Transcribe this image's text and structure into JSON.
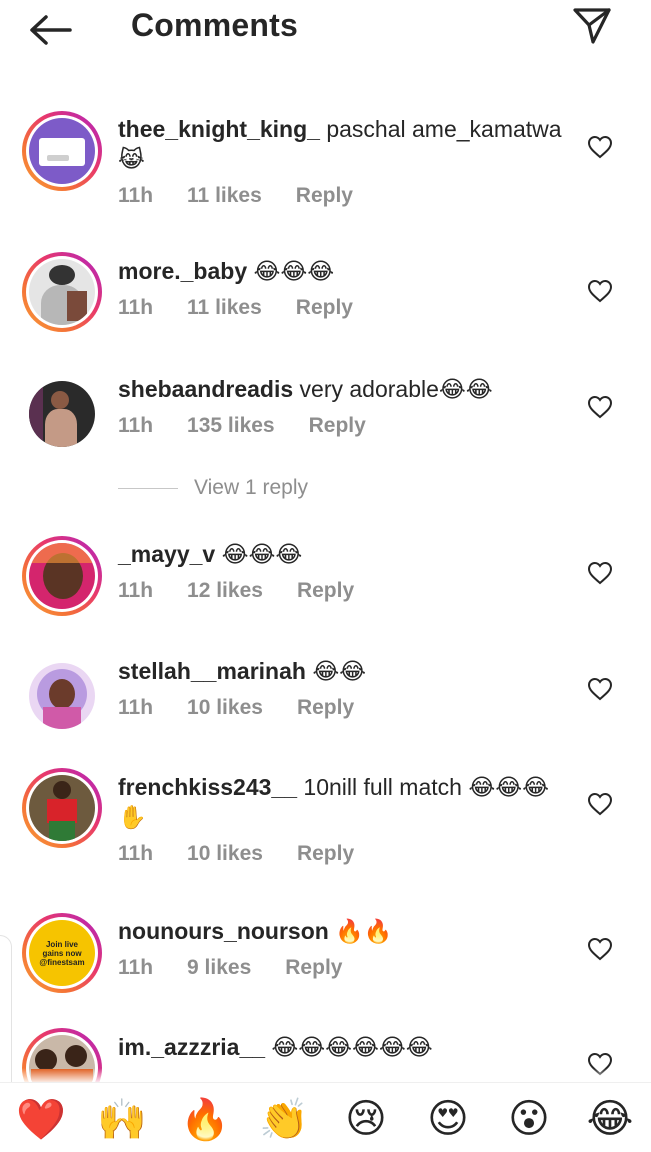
{
  "header": {
    "title": "Comments",
    "back_icon": "arrow-left-icon",
    "share_icon": "paper-plane-icon"
  },
  "comments": [
    {
      "username": "thee_knight_king_",
      "text": "paschal ame_kamatwa 😹",
      "time": "11h",
      "likes": "11 likes",
      "reply": "Reply"
    },
    {
      "username": "more._baby",
      "text": "😂😂😂",
      "time": "11h",
      "likes": "11 likes",
      "reply": "Reply"
    },
    {
      "username": "shebaandreadis",
      "text": "very adorable😂😂",
      "time": "11h",
      "likes": "135 likes",
      "reply": "Reply"
    },
    {
      "username": "_mayy_v",
      "text": "😂😂😂",
      "time": "11h",
      "likes": "12 likes",
      "reply": "Reply"
    },
    {
      "username": "stellah__marinah",
      "text": "😂😂",
      "time": "11h",
      "likes": "10 likes",
      "reply": "Reply"
    },
    {
      "username": "frenchkiss243__",
      "text": "10nill full match 😂😂😂✋",
      "time": "11h",
      "likes": "10 likes",
      "reply": "Reply"
    },
    {
      "username": "nounours_nourson",
      "text": "🔥🔥",
      "time": "11h",
      "likes": "9 likes",
      "reply": "Reply"
    },
    {
      "username": "im._azzzria__",
      "text": "😂😂😂😂😂😂",
      "time": "",
      "likes": "",
      "reply": ""
    }
  ],
  "view_replies": {
    "label": "View 1 reply"
  },
  "avatar_texts": {
    "nounours": "Join live gains now @finestsam"
  },
  "quick_reactions": [
    "❤️",
    "🙌",
    "🔥",
    "👏",
    "😢",
    "😍",
    "😮",
    "😂"
  ],
  "colors": {
    "text": "#262626",
    "secondary": "#8e8e8e",
    "ring_start": "#f9a23a",
    "ring_end": "#c32aa3",
    "avatar_yellow": "#f6c400"
  }
}
